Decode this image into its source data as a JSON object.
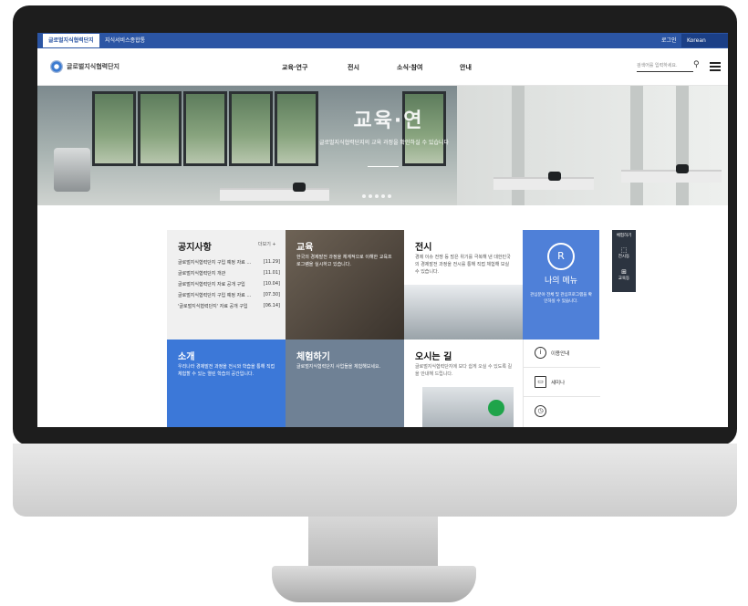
{
  "topbar": {
    "tab1": "글로벌지식협력단지",
    "tab2": "지식서비스종합통",
    "login": "로그인",
    "lang": "Korean"
  },
  "header": {
    "logo": "글로벌지식협력단지",
    "menu": [
      "교육·연구",
      "전시",
      "소식·참여",
      "안내"
    ],
    "search_placeholder": "검색어를 입력하세요."
  },
  "hero": {
    "title": "교육·연",
    "subtitle": "글로벌지식협력단지의 교육 과정을 확인하실 수 있습니다"
  },
  "notice": {
    "title": "공지사항",
    "more": "더보기 +",
    "items": [
      {
        "text": "글로벌지식협력단지 구입 예정 자료 …",
        "date": "[11.29]"
      },
      {
        "text": "글로벌지식협력단지 개관",
        "date": "[11.01]"
      },
      {
        "text": "글로벌지식협력단지 자료 공개 구입",
        "date": "[10.04]"
      },
      {
        "text": "글로벌지식협력단지 구입 예정 자료 …",
        "date": "[07.30]"
      },
      {
        "text": "'글로벌지식협력단지' 자료 공개 구입",
        "date": "[06.14]"
      }
    ]
  },
  "edu": {
    "title": "교육",
    "desc": "한국의 경제발전 과정을 체계적으로 이해한 교육프로그램을 실시하고 있습니다."
  },
  "exhibit": {
    "title": "전시",
    "desc": "경제 이슈 전쟁 등 많은 위기를 극복해 낸 대한민국의 경제발전 과정을 전시를 통해 직접 체험해 보실 수 있습니다."
  },
  "mymenu": {
    "icon": "R",
    "title": "나의 메뉴",
    "desc": "관심분야 전체 및 관심프로그램을 확인하실 수 있습니다."
  },
  "side": {
    "head": "체험하기",
    "items": [
      "전시동",
      "교육동"
    ]
  },
  "intro": {
    "title": "소개",
    "desc": "우리나라 경제발전 과정을 전시와 학습을 통해 직접 체험할 수 있는 열린 학습의 공간입니다."
  },
  "experience": {
    "title": "체험하기",
    "desc": "글로벌지식협력단지 사업들을 체험해보세요."
  },
  "directions": {
    "title": "오시는 길",
    "desc": "글로벌지식협력단지에 보다 쉽게 오실 수 있도록 길을 안내해 드립니다."
  },
  "links": {
    "items": [
      "이용안내",
      "세미나",
      ""
    ]
  }
}
